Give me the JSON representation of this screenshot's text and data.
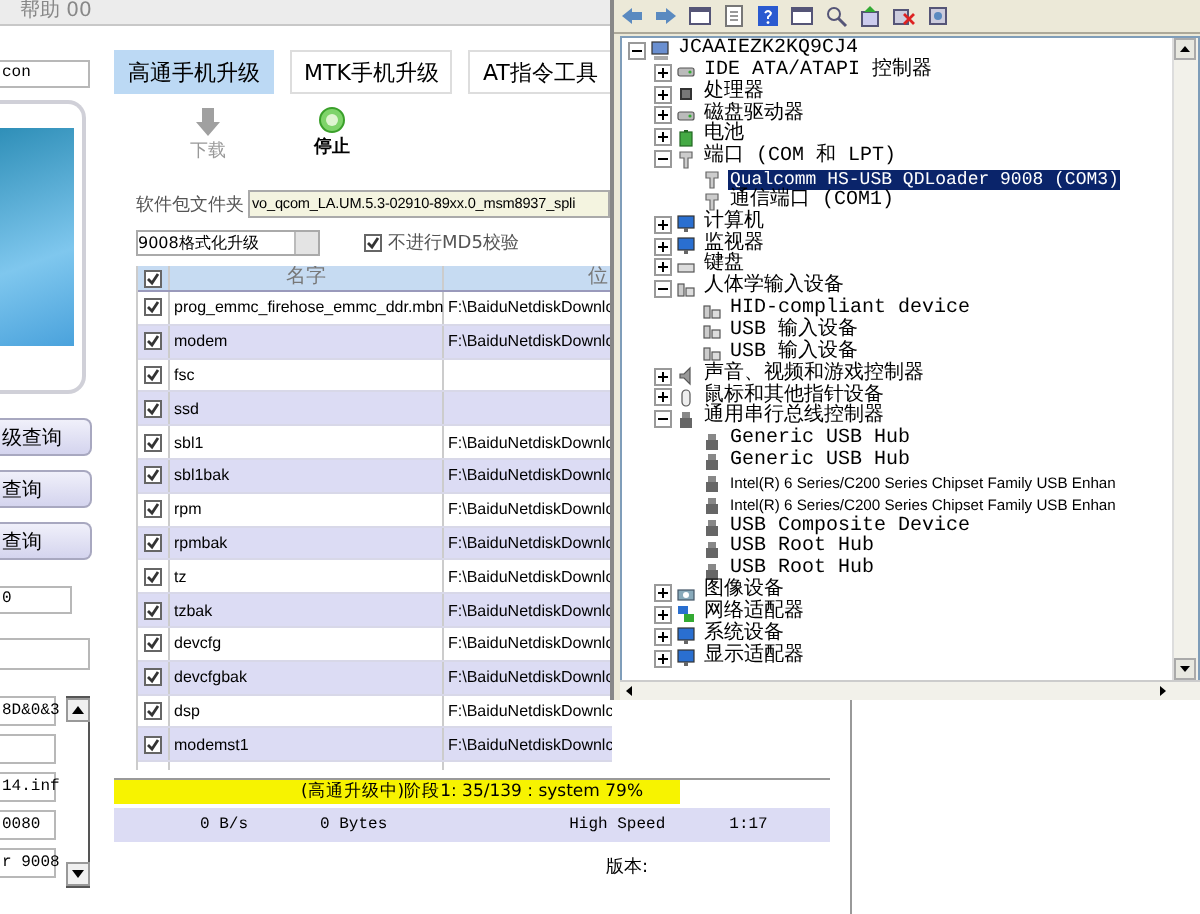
{
  "menu": {
    "label": "帮助 00"
  },
  "left_panel": {
    "top_field": {
      "value": "con"
    },
    "buttons": [
      "级查询",
      "查询",
      "查询"
    ],
    "field_1": {
      "value": "0"
    },
    "list_fields": [
      {
        "value": "8D&0&3"
      },
      {
        "value": "14.inf"
      },
      {
        "value": "0080"
      },
      {
        "value": "r 9008"
      }
    ]
  },
  "tabs": [
    {
      "label": "高通手机升级",
      "selected": true
    },
    {
      "label": "MTK手机升级",
      "selected": false
    },
    {
      "label": "AT指令工具",
      "selected": false
    }
  ],
  "toolbar": [
    {
      "kind": "download",
      "label": "下载",
      "disabled": true
    },
    {
      "kind": "stop",
      "label": "停止",
      "disabled": false
    }
  ],
  "package_folder": {
    "label": "软件包文件夹",
    "value": "vo_qcom_LA.UM.5.3-02910-89xx.0_msm8937_spli"
  },
  "mode_dropdown": {
    "value": "9008格式化升级"
  },
  "md5_checkbox": {
    "label": "不进行MD5校验",
    "checked": true
  },
  "table": {
    "header_checked": true,
    "columns": [
      "名字",
      "位"
    ],
    "rows": [
      {
        "checked": true,
        "name": "prog_emmc_firehose_emmc_ddr.mbn",
        "path": "F:\\BaiduNetdiskDownlc"
      },
      {
        "checked": true,
        "name": "modem",
        "path": "F:\\BaiduNetdiskDownlc"
      },
      {
        "checked": true,
        "name": "fsc"
      },
      {
        "checked": true,
        "name": "ssd"
      },
      {
        "checked": true,
        "name": "sbl1",
        "path": "F:\\BaiduNetdiskDownlc"
      },
      {
        "checked": true,
        "name": "sbl1bak",
        "path": "F:\\BaiduNetdiskDownlc"
      },
      {
        "checked": true,
        "name": "rpm",
        "path": "F:\\BaiduNetdiskDownlc"
      },
      {
        "checked": true,
        "name": "rpmbak",
        "path": "F:\\BaiduNetdiskDownlc"
      },
      {
        "checked": true,
        "name": "tz",
        "path": "F:\\BaiduNetdiskDownlc"
      },
      {
        "checked": true,
        "name": "tzbak",
        "path": "F:\\BaiduNetdiskDownlc"
      },
      {
        "checked": true,
        "name": "devcfg",
        "path": "F:\\BaiduNetdiskDownlc"
      },
      {
        "checked": true,
        "name": "devcfgbak",
        "path": "F:\\BaiduNetdiskDownlc"
      },
      {
        "checked": true,
        "name": "dsp",
        "path": "F:\\BaiduNetdiskDownlc"
      },
      {
        "checked": true,
        "name": "modemst1",
        "path": "F:\\BaiduNetdiskDownlc"
      }
    ]
  },
  "progress": {
    "text": "(高通升级中)阶段1: 35/139 : system 79%",
    "level": 0.79
  },
  "status": [
    "0 B/s",
    "0 Bytes",
    "High Speed",
    "1:17"
  ],
  "version_label": "版本:",
  "device_manager": {
    "tree": {
      "label": "JCAAIEZK2KQ9CJ4",
      "kind": "computer",
      "expanded": true,
      "selected": false,
      "children": [
        {
          "label": "IDE ATA/ATAPI 控制器",
          "kind": "disk",
          "expanded": false,
          "selected": false
        },
        {
          "label": "处理器",
          "kind": "chip",
          "expanded": false,
          "selected": false
        },
        {
          "label": "磁盘驱动器",
          "kind": "disk",
          "expanded": false,
          "selected": false
        },
        {
          "label": "电池",
          "kind": "battery",
          "expanded": false,
          "selected": false
        },
        {
          "label": "端口 (COM 和 LPT)",
          "kind": "plug",
          "expanded": true,
          "selected": false,
          "children": [
            {
              "label": "Qualcomm HS-USB QDLoader 9008 (COM3)",
              "kind": "plug",
              "selected": true
            },
            {
              "label": "通信端口 (COM1)",
              "kind": "plug",
              "selected": false
            }
          ]
        },
        {
          "label": "计算机",
          "kind": "monitor",
          "expanded": false,
          "selected": false
        },
        {
          "label": "监视器",
          "kind": "monitor",
          "expanded": false,
          "selected": false
        },
        {
          "label": "键盘",
          "kind": "keyboard",
          "expanded": false,
          "selected": false
        },
        {
          "label": "人体学输入设备",
          "kind": "hid",
          "expanded": true,
          "selected": false,
          "children": [
            {
              "label": "HID-compliant device",
              "kind": "hid",
              "selected": false
            },
            {
              "label": "USB 输入设备",
              "kind": "hid",
              "selected": false
            },
            {
              "label": "USB 输入设备",
              "kind": "hid",
              "selected": false
            }
          ]
        },
        {
          "label": "声音、视频和游戏控制器",
          "kind": "speaker",
          "expanded": false,
          "selected": false
        },
        {
          "label": "鼠标和其他指针设备",
          "kind": "mouse",
          "expanded": false,
          "selected": false
        },
        {
          "label": "通用串行总线控制器",
          "kind": "usb",
          "expanded": true,
          "selected": false,
          "children": [
            {
              "label": "Generic USB Hub",
              "kind": "usb",
              "selected": false
            },
            {
              "label": "Generic USB Hub",
              "kind": "usb",
              "selected": false
            },
            {
              "label": "Intel(R) 6 Series/C200 Series Chipset Family USB Enhan",
              "kind": "usb",
              "selected": false
            },
            {
              "label": "Intel(R) 6 Series/C200 Series Chipset Family USB Enhan",
              "kind": "usb",
              "selected": false
            },
            {
              "label": "USB Composite Device",
              "kind": "usb",
              "selected": false
            },
            {
              "label": "USB Root Hub",
              "kind": "usb",
              "selected": false
            },
            {
              "label": "USB Root Hub",
              "kind": "usb",
              "selected": false
            }
          ]
        },
        {
          "label": "图像设备",
          "kind": "camera",
          "expanded": false,
          "selected": false
        },
        {
          "label": "网络适配器",
          "kind": "network",
          "expanded": false,
          "selected": false
        },
        {
          "label": "系统设备",
          "kind": "monitor",
          "expanded": false,
          "selected": false
        },
        {
          "label": "显示适配器",
          "kind": "monitor",
          "expanded": false,
          "selected": false
        }
      ]
    }
  }
}
